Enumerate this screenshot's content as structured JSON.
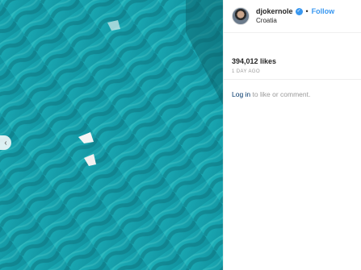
{
  "post": {
    "username": "djokernole",
    "separator": "•",
    "follow_label": "Follow",
    "location": "Croatia",
    "likes": "394,012 likes",
    "timestamp": "1 DAY AGO",
    "login_link": "Log in",
    "login_suffix": " to like or comment."
  },
  "icons": {
    "verified": "verified-badge-icon",
    "carousel_prev": "chevron-left-icon"
  },
  "colors": {
    "accent": "#3897f0",
    "water": "#1aa7b1",
    "link": "#003569",
    "muted": "#999999"
  }
}
